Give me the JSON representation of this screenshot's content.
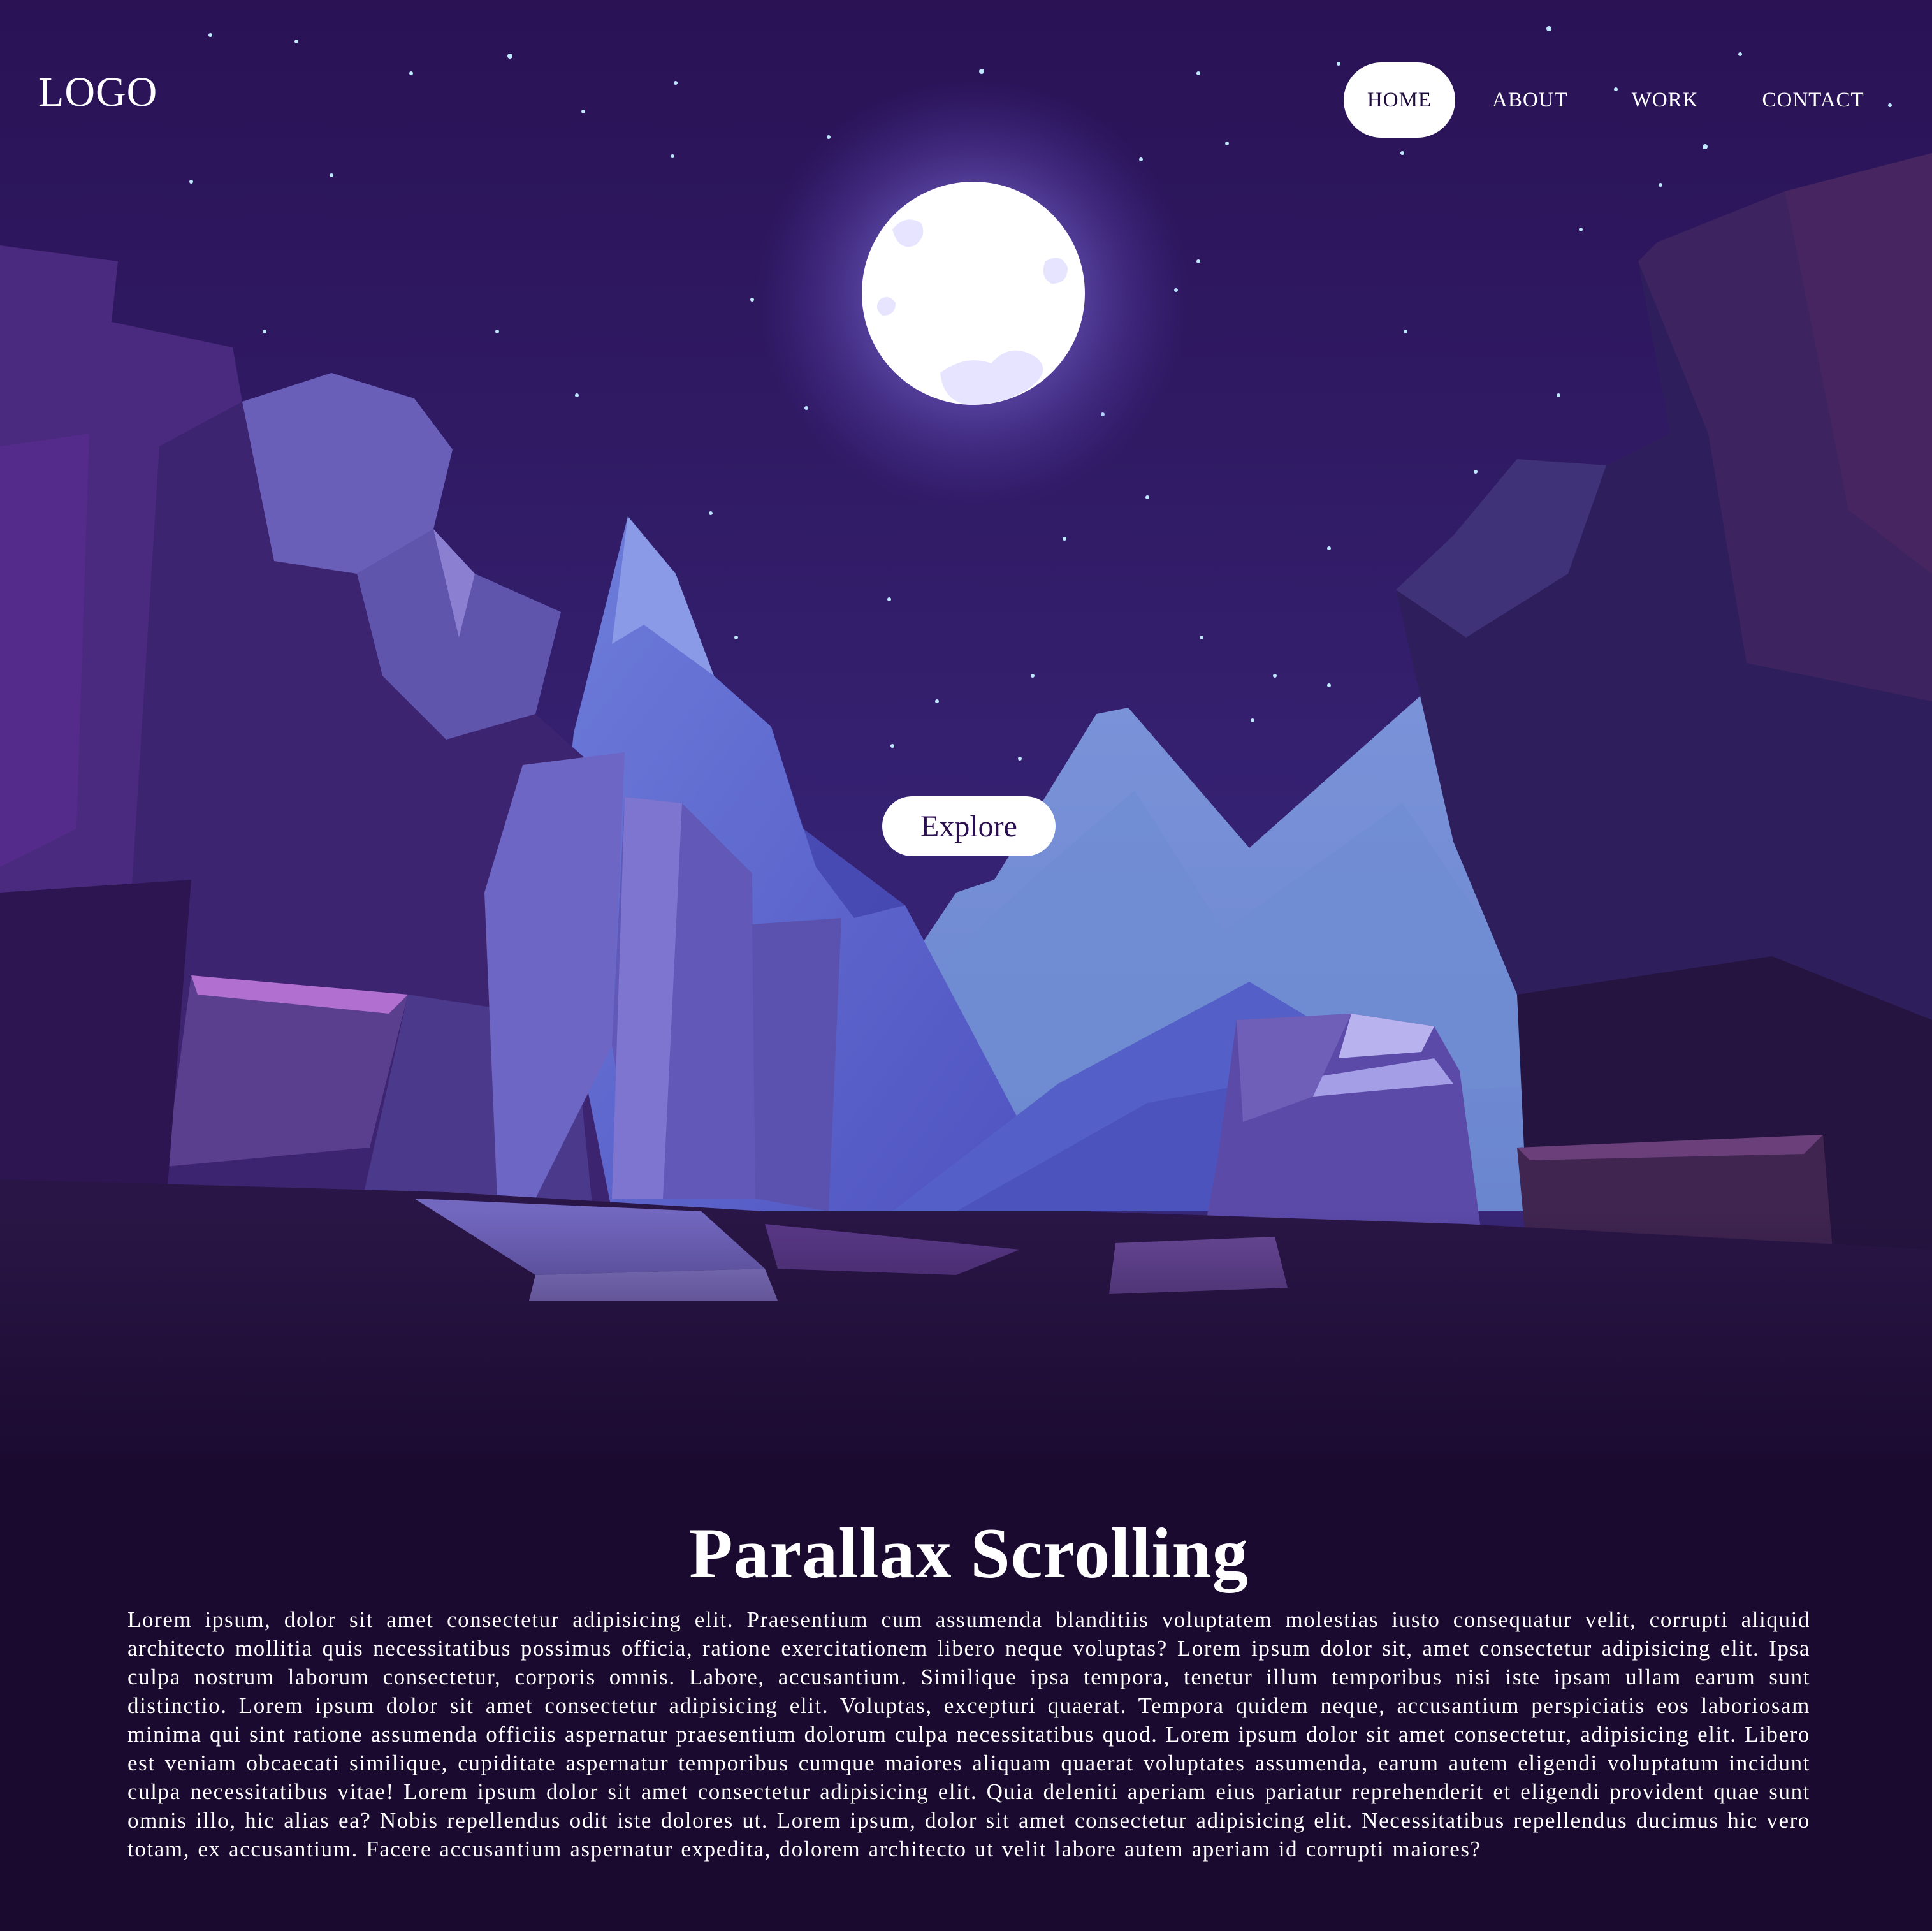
{
  "header": {
    "logo": "LOGO",
    "nav": [
      {
        "label": "HOME",
        "active": true
      },
      {
        "label": "ABOUT",
        "active": false
      },
      {
        "label": "WORK",
        "active": false
      },
      {
        "label": "CONTACT",
        "active": false
      }
    ]
  },
  "hero": {
    "explore_label": "Explore"
  },
  "content": {
    "title": "Parallax Scrolling",
    "body": "Lorem ipsum, dolor sit amet consectetur adipisicing elit. Praesentium cum assumenda blanditiis voluptatem molestias iusto consequatur velit, corrupti aliquid architecto mollitia quis necessitatibus possimus officia, ratione exercitationem libero neque voluptas? Lorem ipsum dolor sit, amet consectetur adipisicing elit. Ipsa culpa nostrum laborum consectetur, corporis omnis. Labore, accusantium. Similique ipsa tempora, tenetur illum temporibus nisi iste ipsam ullam earum sunt distinctio. Lorem ipsum dolor sit amet consectetur adipisicing elit. Voluptas, excepturi quaerat. Tempora quidem neque, accusantium perspiciatis eos laboriosam minima qui sint ratione assumenda officiis aspernatur praesentium dolorum culpa necessitatibus quod. Lorem ipsum dolor sit amet consectetur, adipisicing elit. Libero est veniam obcaecati similique, cupiditate aspernatur temporibus cumque maiores aliquam quaerat voluptates assumenda, earum autem eligendi voluptatum incidunt culpa necessitatibus vitae! Lorem ipsum dolor sit amet consectetur adipisicing elit. Quia deleniti aperiam eius pariatur reprehenderit et eligendi provident quae sunt omnis illo, hic alias ea? Nobis repellendus odit iste dolores ut. Lorem ipsum, dolor sit amet consectetur adipisicing elit. Necessitatibus repellendus ducimus hic vero totam, ex accusantium. Facere accusantium aspernatur expedita, dolorem architecto ut velit labore autem aperiam id corrupti maiores?"
  },
  "colors": {
    "sky": "#2b1358",
    "page_background": "#1b0a30",
    "moon": "#ffffff",
    "mountain_blue": "#6b7fd6",
    "button": "#ffffff"
  }
}
